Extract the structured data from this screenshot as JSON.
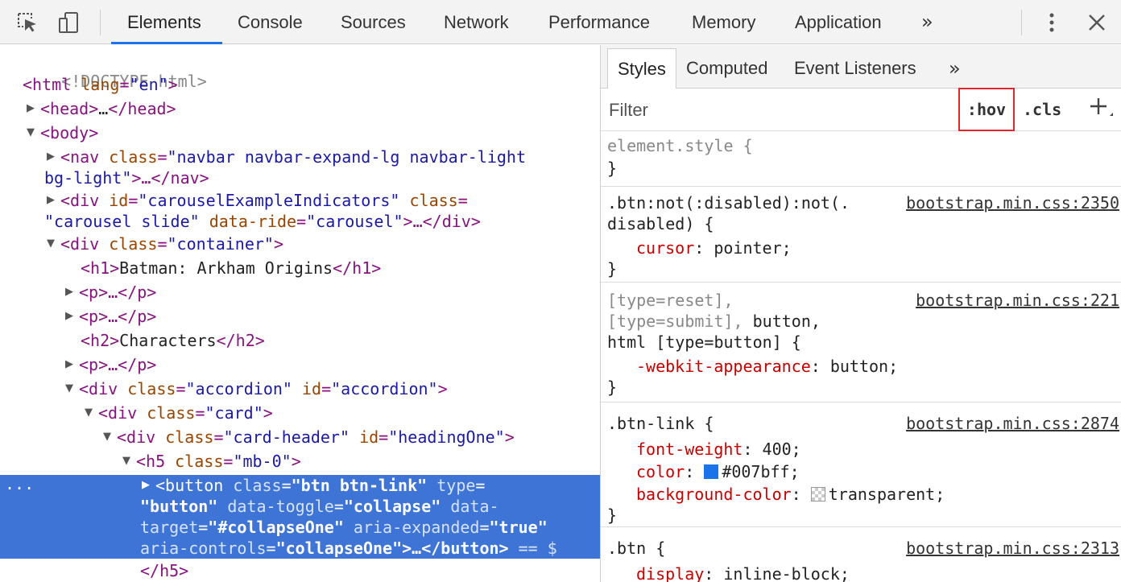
{
  "toolbar": {
    "tabs": [
      "Elements",
      "Console",
      "Sources",
      "Network",
      "Performance",
      "Memory",
      "Application"
    ],
    "more": "»",
    "colors": {
      "accent": "#1a73e8"
    }
  },
  "tree": {
    "doctype": "<!DOCTYPE html>",
    "html_open": "<html",
    "lang_attr": "lang",
    "lang_val": "\"en\"",
    "head_open": "<head>",
    "head_ell": "…",
    "head_close": "</head>",
    "body_open": "<body>",
    "nav_open": "<nav",
    "class_attr": "class",
    "nav_class_1": "\"navbar navbar-expand-lg navbar-light",
    "nav_class_2": "bg-light\"",
    "nav_close": ">…</nav>",
    "carousel_open": "<div",
    "id_attr": "id",
    "carousel_id": "\"carouselExampleIndicators\"",
    "carousel_class": "\"carousel slide\"",
    "data_ride_attr": "data-ride",
    "data_ride_val": "\"carousel\"",
    "carousel_close": ">…</div>",
    "container_class": "\"container\"",
    "h1_open": "<h1>",
    "h1_text": "Batman: Arkham Origins",
    "h1_close": "</h1>",
    "p_collapsed": "<p>…</p>",
    "h2_open": "<h2>",
    "h2_text": "Characters",
    "h2_close": "</h2>",
    "accordion_class": "\"accordion\"",
    "accordion_id": "\"accordion\"",
    "card_class": "\"card\"",
    "card_header_class": "\"card-header\"",
    "heading_id": "\"headingOne\"",
    "h5_open": "<h5",
    "h5_class": "\"mb-0\"",
    "button_open": "<button",
    "btn_class": "\"btn btn-link\"",
    "type_attr": "type",
    "type_val": "\"button\"",
    "data_toggle_attr": "data-toggle",
    "data_toggle_val": "\"collapse\"",
    "data_target_attr_1": "data-",
    "data_target_attr_2": "target",
    "data_target_val": "\"#collapseOne\"",
    "aria_expanded_attr": "aria-expanded",
    "aria_expanded_val": "\"true\"",
    "aria_controls_attr": "aria-controls",
    "aria_controls_val": "\"collapseOne\"",
    "button_close": ">…</button>",
    "eq_marker": "== $",
    "h5_close": "</h5>",
    "ellipsis": "..."
  },
  "styles": {
    "subtabs": [
      "Styles",
      "Computed",
      "Event Listeners"
    ],
    "subtabs_more": "»",
    "filter_placeholder": "Filter",
    "hov_label": ":hov",
    "cls_label": ".cls",
    "hov_border_color": "#e0262d",
    "rules": {
      "element_style": {
        "selector": "element.style {",
        "close": "}"
      },
      "btn_not_disabled": {
        "selector_1": ".btn:not(:disabled):not(.",
        "selector_2": "disabled) {",
        "source": "bootstrap.min.css:2350",
        "prop": "cursor",
        "value": "pointer;",
        "close": "}"
      },
      "type_reset": {
        "selector_1": "[type=reset],",
        "selector_2a": "[type=submit],",
        "selector_2b": "button,",
        "selector_3": "html [type=button] {",
        "source": "bootstrap.min.css:221",
        "prop": "-webkit-appearance",
        "value": "button;",
        "close": "}"
      },
      "btn_link": {
        "selector": ".btn-link {",
        "source": "bootstrap.min.css:2874",
        "p1": "font-weight",
        "v1": "400;",
        "p2": "color",
        "v2": "#007bff;",
        "v2_swatch": "#1a73e8",
        "p3": "background-color",
        "v3": "transparent;",
        "close": "}"
      },
      "btn": {
        "selector": ".btn {",
        "source": "bootstrap.min.css:2313",
        "prop": "display",
        "value": "inline-block;"
      }
    }
  }
}
